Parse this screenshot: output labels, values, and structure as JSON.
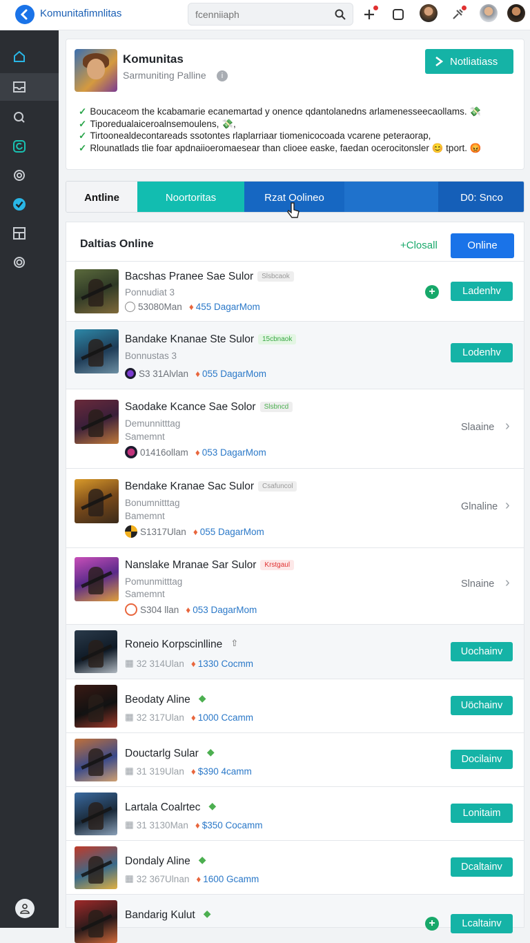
{
  "app": {
    "brand": "Komunitafimnlitas"
  },
  "search": {
    "placeholder": "fcenniiaph"
  },
  "header": {
    "title": "Komunitas",
    "subtitle": "Sarmuniting Palline",
    "notify_label": "Notliatiass",
    "bullets": [
      {
        "text": "Boucaceom the kcabamarie ecanemartad y onence qdantolanedns arlamenesseecaollams. 💸"
      },
      {
        "text": "Tiporedualaiceroalnsemoulens, 💸,"
      },
      {
        "text": "Tirtoonealdecontareads ssotontes rlaplarriaar tiomenicocoada vcarene peteraorap,"
      },
      {
        "text": "Rlounatlads tlie foar apdnaiioeromaesear than clioee easke, faedan ocerocitonsler 😊 tport. 😡"
      }
    ]
  },
  "tabs": [
    {
      "label": "Antline"
    },
    {
      "label": "Noortoritas"
    },
    {
      "label": "Rzat Oolineo"
    },
    {
      "label": ""
    },
    {
      "label": "D0: Snco"
    }
  ],
  "list": {
    "title": "Daltias Online",
    "close_label": "+Closall",
    "online_label": "Online"
  },
  "rows": [
    {
      "title": "Bacshas Pranee Sae Sulor",
      "badge": "Slsbcaok",
      "sub1": "Ponnudiat 3",
      "sub2": "",
      "meta1": "53080Man",
      "meta2": "455 DagarMom",
      "action": "Ladenhv",
      "action_type": "button",
      "plus": "+"
    },
    {
      "title": "Bandake Knanae Ste Sulor",
      "badge": "15cbnaok",
      "sub1": "Bonnustas 3",
      "sub2": "",
      "meta1": "S3 31Alvlan",
      "meta2": "055 DagarMom",
      "action": "Lodenhv",
      "action_type": "button"
    },
    {
      "title": "Saodake Kcance Sae Solor",
      "badge": "Slsbncd",
      "sub1": "Demunnitttag",
      "sub2": "Samemnt",
      "meta1": "01416ollam",
      "meta2": "053 DagarMom",
      "action": "Slaaine",
      "action_type": "link"
    },
    {
      "title": "Bendake Kranae Sac Sulor",
      "badge": "Csafuncol",
      "sub1": "Bonumnitttag",
      "sub2": "Bamemnt",
      "meta1": "S1317Ulan",
      "meta2": "055 DagarMom",
      "action": "Glnaline",
      "action_type": "link"
    },
    {
      "title": "Nanslake Mranae Sar Sulor",
      "badge": "Krstgaul",
      "sub1": "Pomunmitttag",
      "sub2": "Samemnt",
      "meta1": "S304 llan",
      "meta2": "053 DagarMom",
      "action": "Slnaine",
      "action_type": "link"
    },
    {
      "title": "Roneio Korpscinlline",
      "badge": "⇧",
      "sub1": "",
      "sub2": "",
      "meta1": "32 314Ulan",
      "meta2": "1330 Cocmm",
      "action": "Uochainv",
      "action_type": "button"
    },
    {
      "title": "Beodaty Aline",
      "badge": "◆",
      "sub1": "",
      "sub2": "",
      "meta1": "32 317Ulan",
      "meta2": "1000 Ccamm",
      "action": "Uöchainv",
      "action_type": "button"
    },
    {
      "title": "Douctarlg Sular",
      "badge": "◆",
      "sub1": "",
      "sub2": "",
      "meta1": "31 319Ulan",
      "meta2": "$390 4camm",
      "action": "Docilainv",
      "action_type": "button"
    },
    {
      "title": "Lartala Coalrtec",
      "badge": "◆",
      "sub1": "",
      "sub2": "",
      "meta1": "31 3130Man",
      "meta2": "$350 Cocamm",
      "action": "Lonitaim",
      "action_type": "button"
    },
    {
      "title": "Dondaly Aline",
      "badge": "◆",
      "sub1": "",
      "sub2": "",
      "meta1": "32 367Ulnan",
      "meta2": "1600 Gcamm",
      "action": "Dcaltainv",
      "action_type": "button"
    },
    {
      "title": "Bandarig Kulut",
      "badge": "◆",
      "sub1": "",
      "sub2": "",
      "meta1": "",
      "meta2": "",
      "action": "Lcaltainv",
      "action_type": "button",
      "plus": "+"
    }
  ],
  "colors": {
    "accent": "#15b3a6",
    "primary": "#1a73e8",
    "sidebar": "#2b2e33"
  }
}
